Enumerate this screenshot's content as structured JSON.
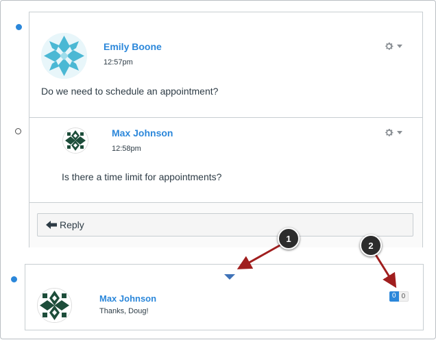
{
  "thread": {
    "entry": {
      "author": "Emily Boone",
      "time": "12:57pm",
      "message": "Do we need to schedule an appointment?"
    },
    "reply": {
      "author": "Max Johnson",
      "time": "12:58pm",
      "message": "Is there a time limit for appointments?"
    },
    "reply_button_label": "Reply"
  },
  "second_entry": {
    "author": "Max Johnson",
    "message": "Thanks, Doug!",
    "like_count_primary": "0",
    "like_count_secondary": "0"
  },
  "callouts": [
    "1",
    "2"
  ],
  "colors": {
    "accent": "#2b87da",
    "callout_arrow": "#a01e1e",
    "avatar_teal": "#4bb8d4",
    "avatar_green": "#1d4d3a"
  },
  "icons": {
    "settings": "gear-icon",
    "reply": "arrow-left-icon",
    "expand": "caret-down-icon"
  }
}
